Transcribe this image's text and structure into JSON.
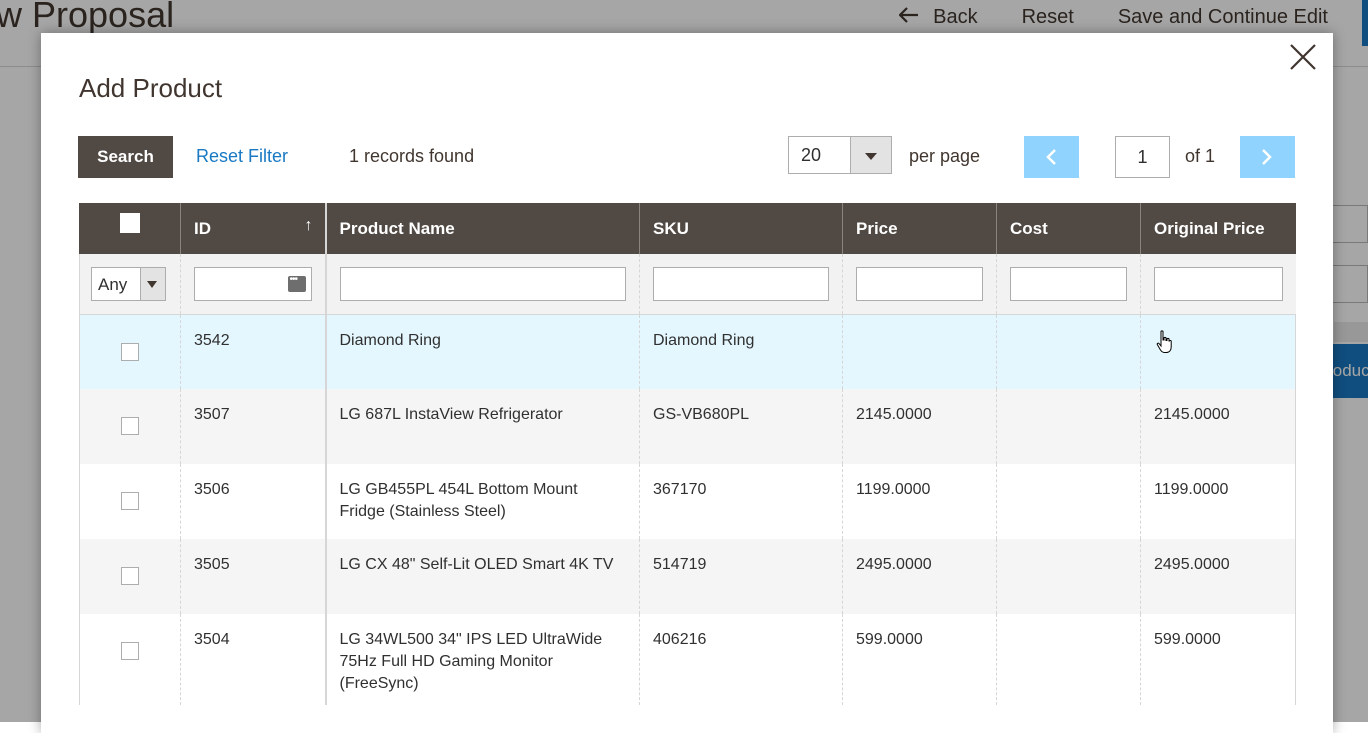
{
  "background": {
    "page_title": "w Proposal",
    "actions": {
      "back": "Back",
      "reset": "Reset",
      "save_continue": "Save and Continue Edit"
    },
    "partial_button": "oduc"
  },
  "modal": {
    "title": "Add Product",
    "close_icon": "close-icon",
    "toolbar": {
      "search_label": "Search",
      "reset_filter_label": "Reset Filter",
      "records_found": "1 records found",
      "per_page_value": "20",
      "per_page_label": "per page",
      "current_page": "1",
      "of_pages": "of 1"
    },
    "grid": {
      "columns": {
        "id": "ID",
        "product_name": "Product Name",
        "sku": "SKU",
        "price": "Price",
        "cost": "Cost",
        "original_price": "Original Price"
      },
      "sort_indicator": "↑",
      "filters": {
        "select_any": "Any"
      },
      "rows": [
        {
          "id": "3542",
          "name": "Diamond Ring",
          "sku": "Diamond Ring",
          "price": "",
          "cost": "",
          "original_price": ""
        },
        {
          "id": "3507",
          "name": "LG 687L InstaView Refrigerator",
          "sku": "GS-VB680PL",
          "price": "2145.0000",
          "cost": "",
          "original_price": "2145.0000"
        },
        {
          "id": "3506",
          "name": "LG GB455PL 454L Bottom Mount Fridge (Stainless Steel)",
          "sku": "367170",
          "price": "1199.0000",
          "cost": "",
          "original_price": "1199.0000"
        },
        {
          "id": "3505",
          "name": "LG CX 48\" Self-Lit OLED Smart 4K TV",
          "sku": "514719",
          "price": "2495.0000",
          "cost": "",
          "original_price": "2495.0000"
        },
        {
          "id": "3504",
          "name": "LG 34WL500 34\" IPS LED UltraWide 75Hz Full HD Gaming Monitor (FreeSync)",
          "sku": "406216",
          "price": "599.0000",
          "cost": "",
          "original_price": "599.0000"
        }
      ]
    }
  },
  "colors": {
    "header_bg": "#514943",
    "link": "#1979c3",
    "pager_button": "#8fd3fe",
    "selected_row": "#e5f7fe"
  }
}
